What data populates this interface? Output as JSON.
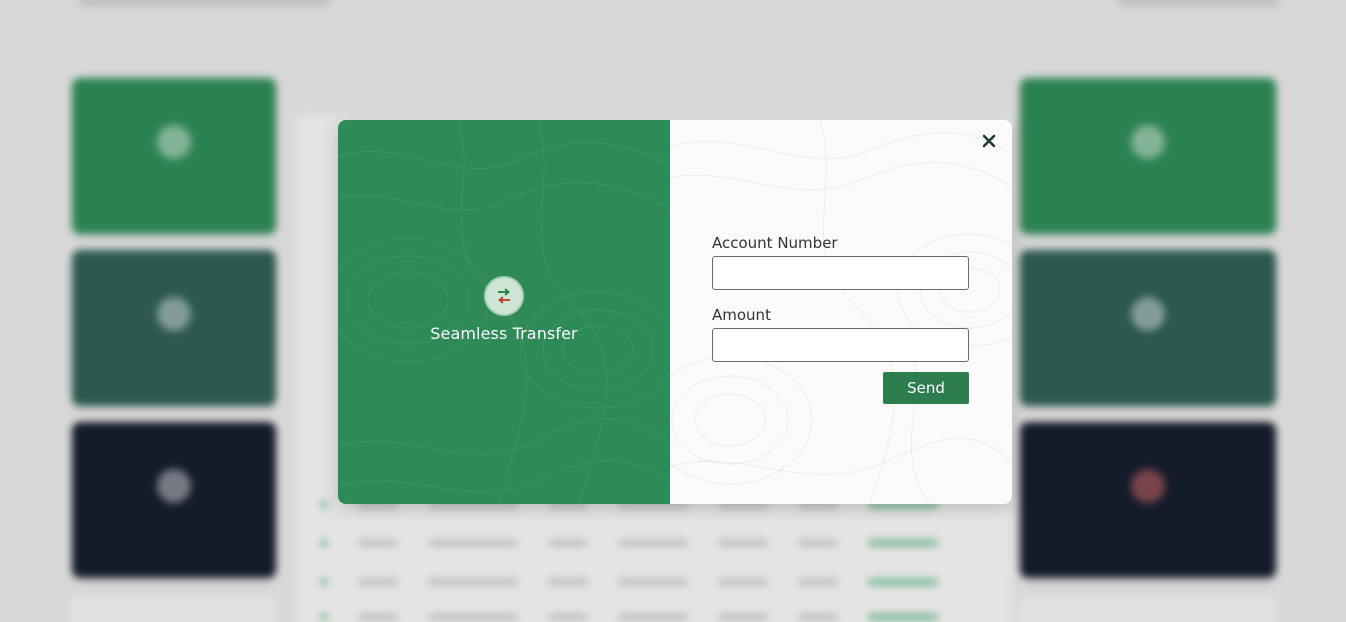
{
  "modal": {
    "left_title": "Seamless Transfer",
    "transfer_icon": "transfer-arrows-icon",
    "close_icon": "close-icon",
    "fields": {
      "account_number_label": "Account Number",
      "account_number_value": "",
      "amount_label": "Amount",
      "amount_value": ""
    },
    "send_label": "Send"
  },
  "colors": {
    "primary_green": "#2e8b57",
    "button_green": "#2e7d4f",
    "teal_card": "#2f5e55",
    "navy_card": "#161d2e"
  }
}
